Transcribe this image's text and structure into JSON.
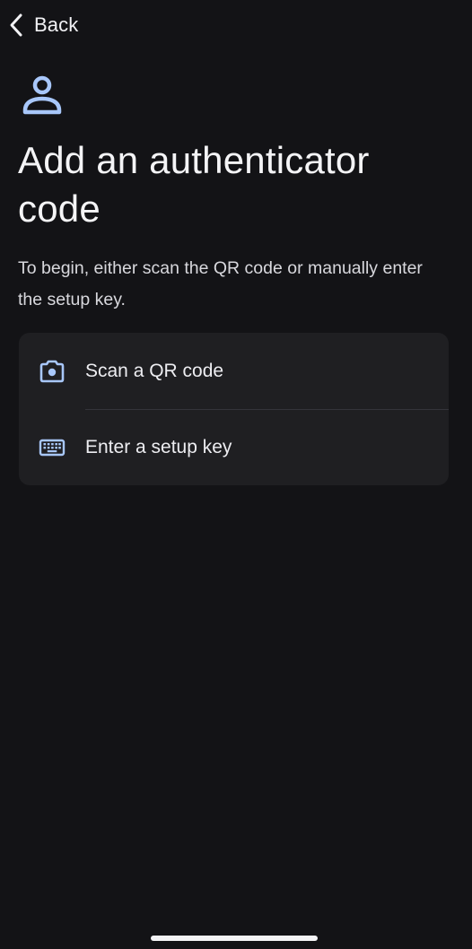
{
  "nav": {
    "back_label": "Back",
    "back_icon": "chevron-left-icon"
  },
  "header": {
    "icon": "person-icon",
    "title": "Add an authenticator code",
    "subtitle": "To begin, either scan the QR code or manually enter the setup key."
  },
  "options": [
    {
      "label": "Scan a QR code",
      "icon": "camera-icon"
    },
    {
      "label": "Enter a setup key",
      "icon": "keyboard-icon"
    }
  ],
  "colors": {
    "background": "#131316",
    "card": "#1f1f22",
    "accent_icon": "#a8c7fa",
    "text": "#ededf1"
  }
}
